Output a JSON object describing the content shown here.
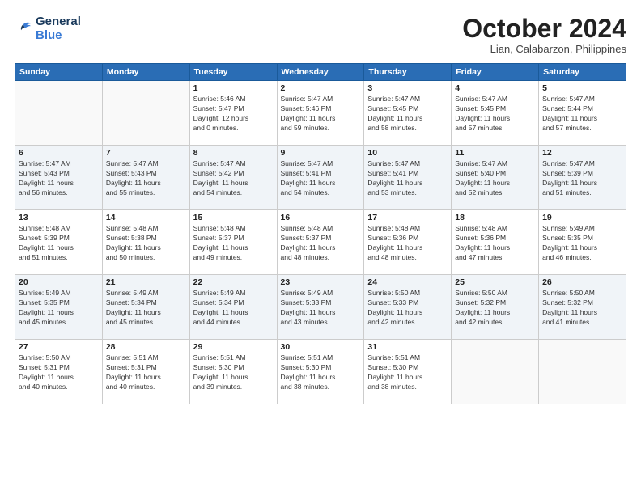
{
  "header": {
    "logo_line1": "General",
    "logo_line2": "Blue",
    "month": "October 2024",
    "location": "Lian, Calabarzon, Philippines"
  },
  "weekdays": [
    "Sunday",
    "Monday",
    "Tuesday",
    "Wednesday",
    "Thursday",
    "Friday",
    "Saturday"
  ],
  "weeks": [
    [
      {
        "day": "",
        "info": ""
      },
      {
        "day": "",
        "info": ""
      },
      {
        "day": "1",
        "info": "Sunrise: 5:46 AM\nSunset: 5:47 PM\nDaylight: 12 hours\nand 0 minutes."
      },
      {
        "day": "2",
        "info": "Sunrise: 5:47 AM\nSunset: 5:46 PM\nDaylight: 11 hours\nand 59 minutes."
      },
      {
        "day": "3",
        "info": "Sunrise: 5:47 AM\nSunset: 5:45 PM\nDaylight: 11 hours\nand 58 minutes."
      },
      {
        "day": "4",
        "info": "Sunrise: 5:47 AM\nSunset: 5:45 PM\nDaylight: 11 hours\nand 57 minutes."
      },
      {
        "day": "5",
        "info": "Sunrise: 5:47 AM\nSunset: 5:44 PM\nDaylight: 11 hours\nand 57 minutes."
      }
    ],
    [
      {
        "day": "6",
        "info": "Sunrise: 5:47 AM\nSunset: 5:43 PM\nDaylight: 11 hours\nand 56 minutes."
      },
      {
        "day": "7",
        "info": "Sunrise: 5:47 AM\nSunset: 5:43 PM\nDaylight: 11 hours\nand 55 minutes."
      },
      {
        "day": "8",
        "info": "Sunrise: 5:47 AM\nSunset: 5:42 PM\nDaylight: 11 hours\nand 54 minutes."
      },
      {
        "day": "9",
        "info": "Sunrise: 5:47 AM\nSunset: 5:41 PM\nDaylight: 11 hours\nand 54 minutes."
      },
      {
        "day": "10",
        "info": "Sunrise: 5:47 AM\nSunset: 5:41 PM\nDaylight: 11 hours\nand 53 minutes."
      },
      {
        "day": "11",
        "info": "Sunrise: 5:47 AM\nSunset: 5:40 PM\nDaylight: 11 hours\nand 52 minutes."
      },
      {
        "day": "12",
        "info": "Sunrise: 5:47 AM\nSunset: 5:39 PM\nDaylight: 11 hours\nand 51 minutes."
      }
    ],
    [
      {
        "day": "13",
        "info": "Sunrise: 5:48 AM\nSunset: 5:39 PM\nDaylight: 11 hours\nand 51 minutes."
      },
      {
        "day": "14",
        "info": "Sunrise: 5:48 AM\nSunset: 5:38 PM\nDaylight: 11 hours\nand 50 minutes."
      },
      {
        "day": "15",
        "info": "Sunrise: 5:48 AM\nSunset: 5:37 PM\nDaylight: 11 hours\nand 49 minutes."
      },
      {
        "day": "16",
        "info": "Sunrise: 5:48 AM\nSunset: 5:37 PM\nDaylight: 11 hours\nand 48 minutes."
      },
      {
        "day": "17",
        "info": "Sunrise: 5:48 AM\nSunset: 5:36 PM\nDaylight: 11 hours\nand 48 minutes."
      },
      {
        "day": "18",
        "info": "Sunrise: 5:48 AM\nSunset: 5:36 PM\nDaylight: 11 hours\nand 47 minutes."
      },
      {
        "day": "19",
        "info": "Sunrise: 5:49 AM\nSunset: 5:35 PM\nDaylight: 11 hours\nand 46 minutes."
      }
    ],
    [
      {
        "day": "20",
        "info": "Sunrise: 5:49 AM\nSunset: 5:35 PM\nDaylight: 11 hours\nand 45 minutes."
      },
      {
        "day": "21",
        "info": "Sunrise: 5:49 AM\nSunset: 5:34 PM\nDaylight: 11 hours\nand 45 minutes."
      },
      {
        "day": "22",
        "info": "Sunrise: 5:49 AM\nSunset: 5:34 PM\nDaylight: 11 hours\nand 44 minutes."
      },
      {
        "day": "23",
        "info": "Sunrise: 5:49 AM\nSunset: 5:33 PM\nDaylight: 11 hours\nand 43 minutes."
      },
      {
        "day": "24",
        "info": "Sunrise: 5:50 AM\nSunset: 5:33 PM\nDaylight: 11 hours\nand 42 minutes."
      },
      {
        "day": "25",
        "info": "Sunrise: 5:50 AM\nSunset: 5:32 PM\nDaylight: 11 hours\nand 42 minutes."
      },
      {
        "day": "26",
        "info": "Sunrise: 5:50 AM\nSunset: 5:32 PM\nDaylight: 11 hours\nand 41 minutes."
      }
    ],
    [
      {
        "day": "27",
        "info": "Sunrise: 5:50 AM\nSunset: 5:31 PM\nDaylight: 11 hours\nand 40 minutes."
      },
      {
        "day": "28",
        "info": "Sunrise: 5:51 AM\nSunset: 5:31 PM\nDaylight: 11 hours\nand 40 minutes."
      },
      {
        "day": "29",
        "info": "Sunrise: 5:51 AM\nSunset: 5:30 PM\nDaylight: 11 hours\nand 39 minutes."
      },
      {
        "day": "30",
        "info": "Sunrise: 5:51 AM\nSunset: 5:30 PM\nDaylight: 11 hours\nand 38 minutes."
      },
      {
        "day": "31",
        "info": "Sunrise: 5:51 AM\nSunset: 5:30 PM\nDaylight: 11 hours\nand 38 minutes."
      },
      {
        "day": "",
        "info": ""
      },
      {
        "day": "",
        "info": ""
      }
    ]
  ]
}
